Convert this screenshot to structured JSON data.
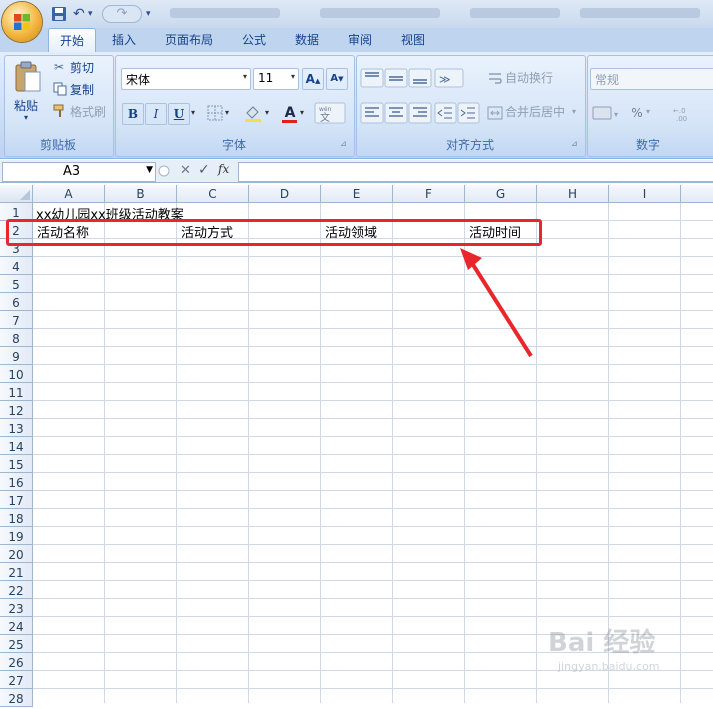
{
  "quick_access": {
    "undo_label": "↶",
    "redo_label": "↷"
  },
  "tabs": [
    {
      "label": "开始",
      "active": true
    },
    {
      "label": "插入"
    },
    {
      "label": "页面布局"
    },
    {
      "label": "公式"
    },
    {
      "label": "数据"
    },
    {
      "label": "审阅"
    },
    {
      "label": "视图"
    }
  ],
  "clipboard": {
    "paste_label": "粘贴",
    "cut_label": "剪切",
    "copy_label": "复制",
    "format_painter_label": "格式刷",
    "group_title": "剪贴板"
  },
  "font": {
    "font_name": "宋体",
    "font_size": "11",
    "bold": "B",
    "italic": "I",
    "underline": "U",
    "font_color_glyph": "A",
    "grow_glyph": "A",
    "shrink_glyph": "A",
    "group_title": "字体",
    "accent_color": "#e0201a"
  },
  "alignment": {
    "wrap_text_label": "自动换行",
    "merge_center_label": "合并后居中",
    "group_title": "对齐方式"
  },
  "number": {
    "format_value": "常规",
    "percent_glyph": "%",
    "group_title": "数字"
  },
  "formula_bar": {
    "name_box": "A3",
    "cancel_glyph": "✕",
    "enter_glyph": "✓",
    "fx_glyph": "fx",
    "formula": ""
  },
  "columns": [
    "A",
    "B",
    "C",
    "D",
    "E",
    "F",
    "G",
    "H",
    "I"
  ],
  "rows": [
    "1",
    "2",
    "3",
    "4",
    "5",
    "6",
    "7",
    "8",
    "9",
    "10",
    "11",
    "12",
    "13",
    "14",
    "15",
    "16",
    "17",
    "18",
    "19",
    "20",
    "21",
    "22",
    "23",
    "24",
    "25",
    "26",
    "27",
    "28"
  ],
  "cells": {
    "a1": "xx幼儿园xx班级活动教案",
    "a2": "活动名称",
    "c2": "活动方式",
    "e2": "活动领域",
    "g2": "活动时间"
  },
  "annotation_color": "#e8262b",
  "watermark": {
    "brand": "Bai 经验",
    "url": "jingyan.baidu.com"
  }
}
